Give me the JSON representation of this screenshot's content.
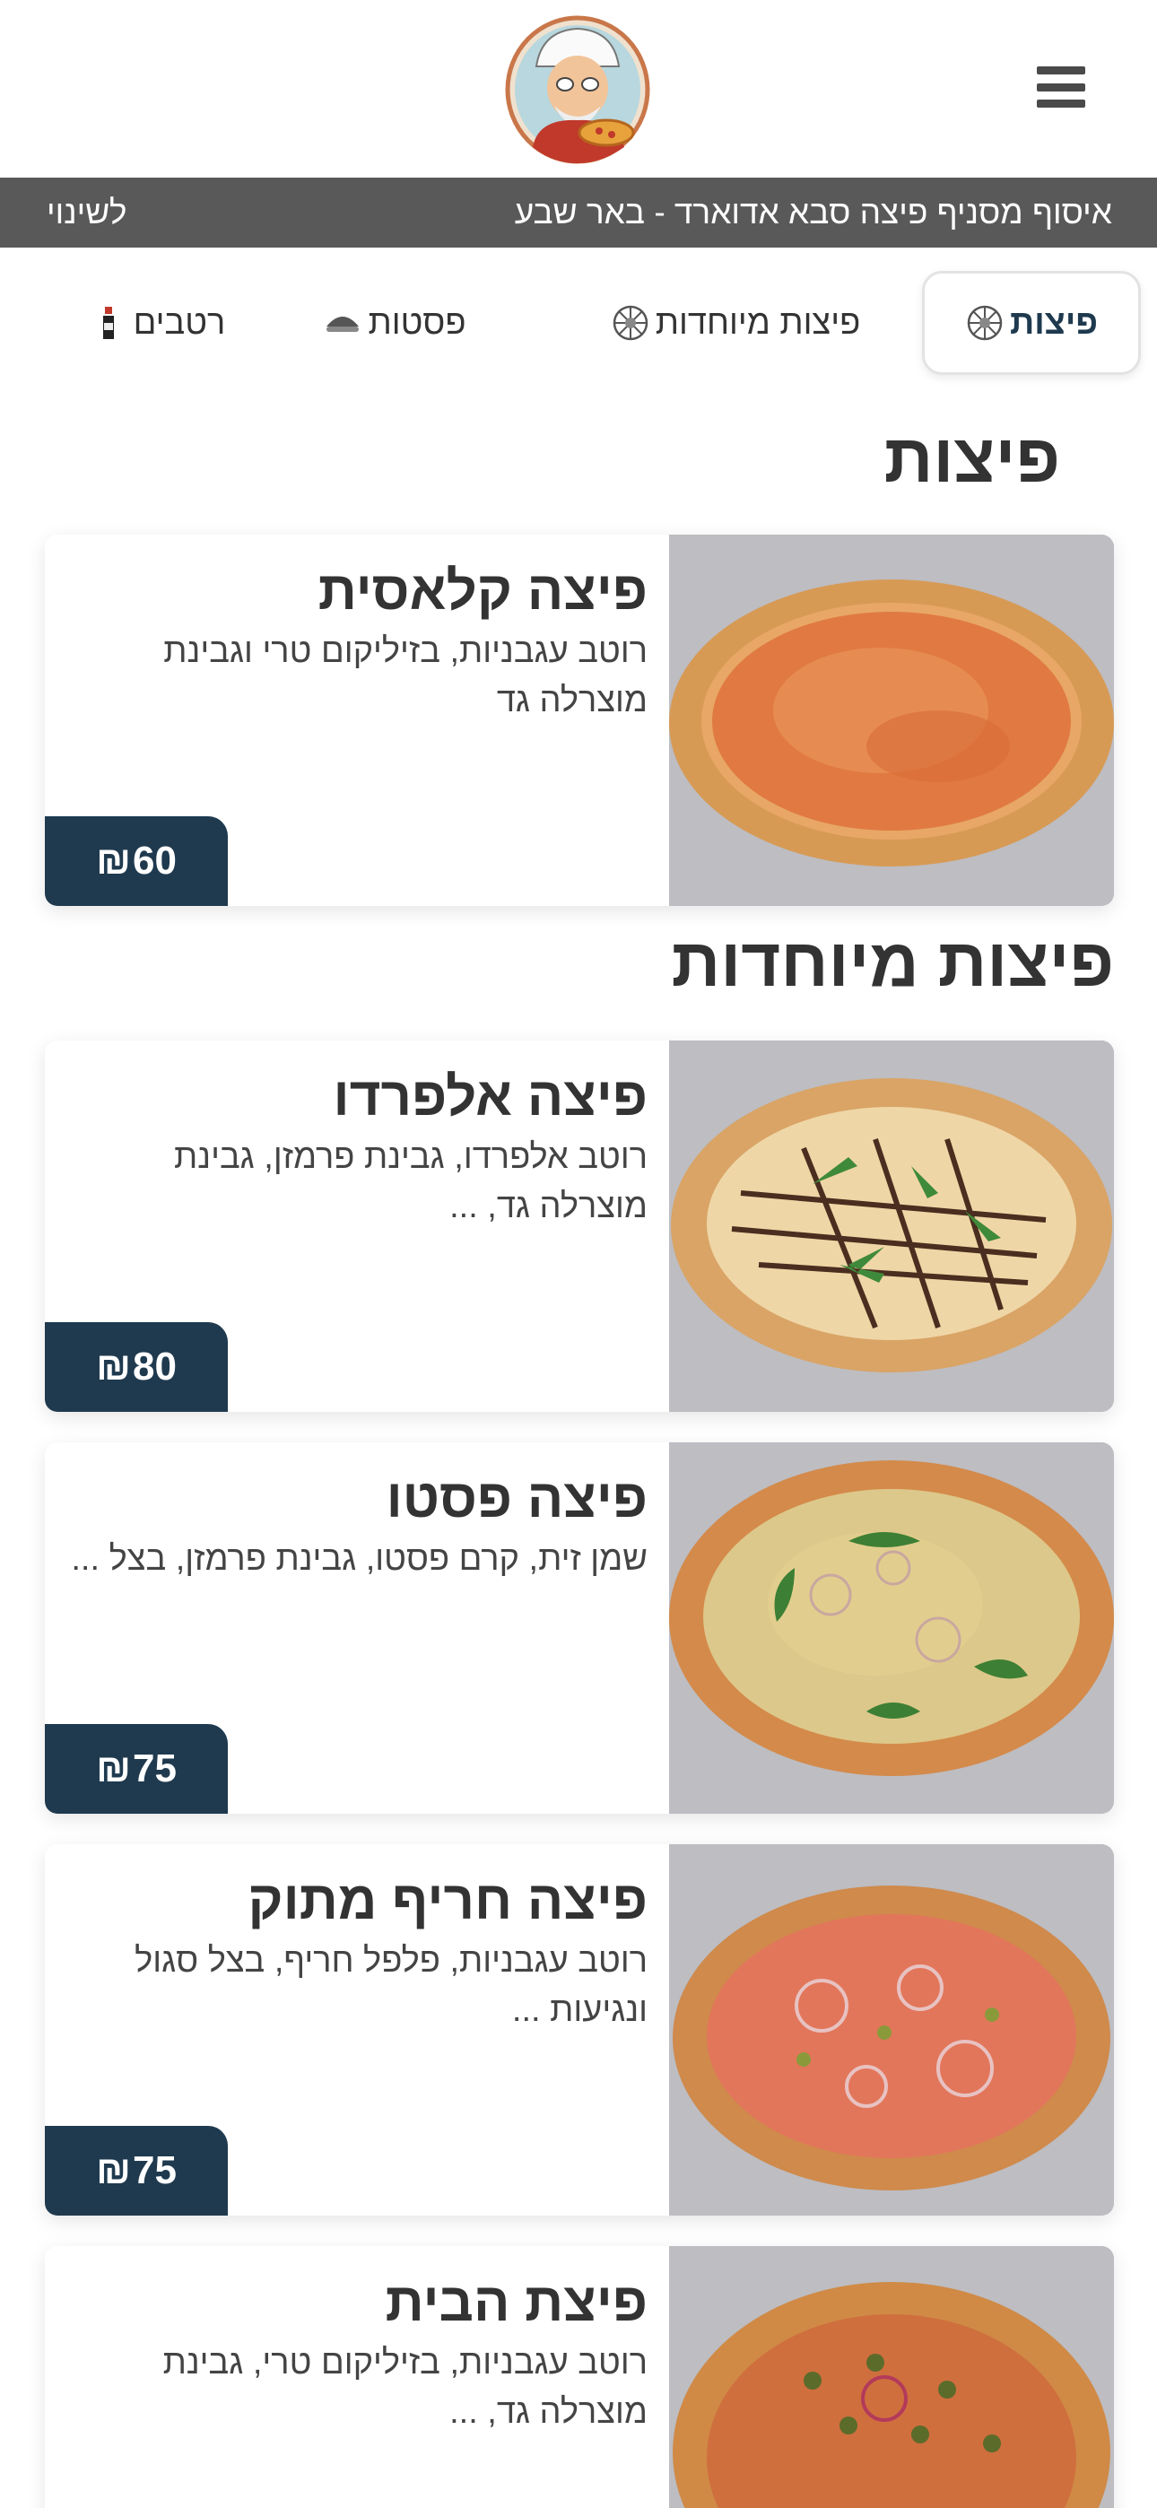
{
  "header": {
    "menu_icon": "hamburger-icon",
    "logo": "pizza-chef-logo"
  },
  "banner": {
    "pickup_text": "איסוף מסניף פיצה סבא אדוארד - באר שבע",
    "change_label": "לשינוי",
    "background": "#595959"
  },
  "tabs": [
    {
      "label": "פיצות",
      "icon": "pizza-icon",
      "active": true
    },
    {
      "label": "פיצות מיוחדות",
      "icon": "pizza-icon",
      "active": false
    },
    {
      "label": "פסטות",
      "icon": "pasta-icon",
      "active": false
    },
    {
      "label": "רטבים",
      "icon": "sauce-bottle-icon",
      "active": false
    }
  ],
  "sections": [
    {
      "title": "פיצות",
      "items": [
        {
          "name": "פיצה קלאסית",
          "description": "רוטב עגבניות, בזיליקום טרי וגבינת מוצרלה גד",
          "price": "60",
          "currency": "₪"
        }
      ]
    },
    {
      "title": "פיצות מיוחדות",
      "items": [
        {
          "name": "פיצה אלפרדו",
          "description": "רוטב אלפרדו, גבינת פרמזן, גבינת מוצרלה גד, ...",
          "price": "80",
          "currency": "₪"
        },
        {
          "name": "פיצה פסטו",
          "description": "שמן זית, קרם פסטו, גבינת פרמזן, בצל ...",
          "price": "75",
          "currency": "₪"
        },
        {
          "name": "פיצה חריף מתוק",
          "description": "רוטב עגבניות, פלפל חריף, בצל סגול ונגיעות ...",
          "price": "75",
          "currency": "₪"
        },
        {
          "name": "פיצת הבית",
          "description": "רוטב עגבניות, בזיליקום טרי, גבינת מוצרלה גד, ...",
          "price": "",
          "currency": ""
        }
      ]
    }
  ],
  "colors": {
    "accent": "#1f3a4f",
    "banner": "#595959",
    "text": "#333333"
  }
}
